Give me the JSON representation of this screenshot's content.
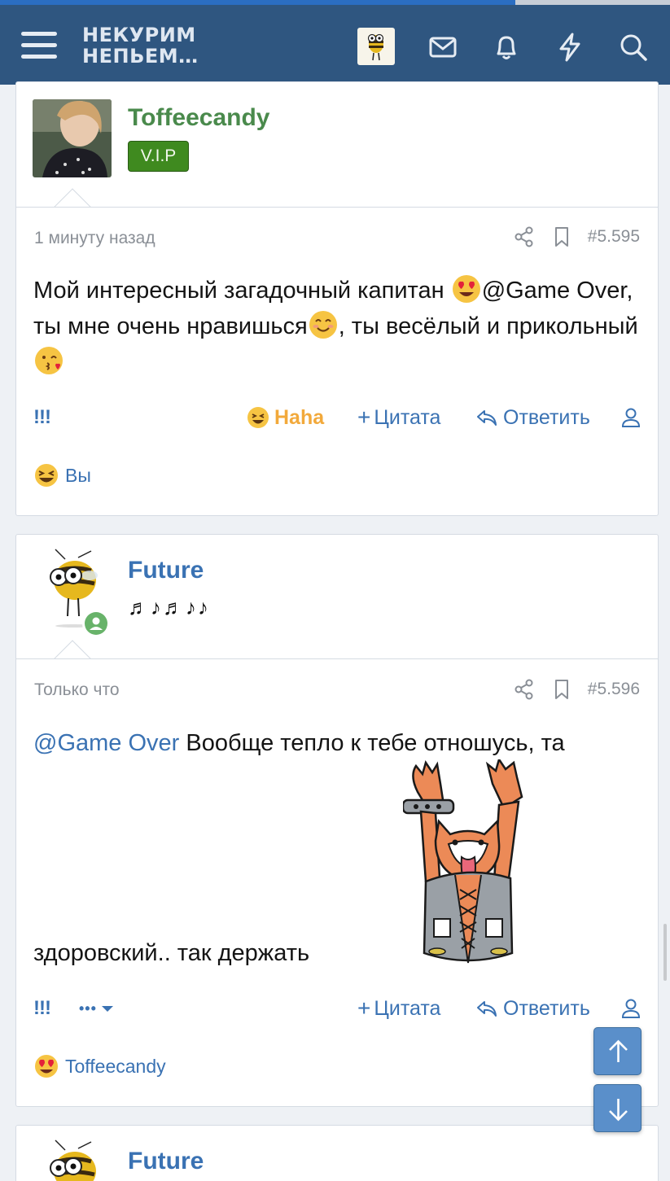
{
  "header": {
    "logo_line1": "НЕКУРИМ",
    "logo_line2": "НЕПЬЕМ…",
    "icons": [
      "menu-icon",
      "bee-avatar-icon",
      "mail-icon",
      "bell-icon",
      "lightning-icon",
      "search-icon"
    ]
  },
  "posts": [
    {
      "username": "Toffeecandy",
      "username_color": "#4a8a4c",
      "badge": "V.I.P",
      "time": "1 минуту назад",
      "number": "#5.595",
      "text_part1": "Мой интересный загадочный капитан ",
      "text_part2": "@Game Over, ты мне очень нравишься",
      "text_part3": ", ты весёлый и прикольный ",
      "bang": "!!!",
      "haha_label": "Haha",
      "quote_label": "Цитата",
      "reply_label": "Ответить",
      "reaction_user": "Вы"
    },
    {
      "username": "Future",
      "username_color": "#3a72b3",
      "user_title": "♬♪♬♪♪",
      "time": "Только что",
      "number": "#5.596",
      "mention": "@Game Over",
      "text_part1": " Вообще тепло к тебе отношусь, та",
      "text_part2": "здоровский.. так держать",
      "bang": "!!!",
      "more": "•••",
      "quote_label": "Цитата",
      "reply_label": "Ответить",
      "reaction_user": "Toffeecandy"
    },
    {
      "username": "Future",
      "username_color": "#3a72b3"
    }
  ],
  "colors": {
    "header_bg": "#2f5680",
    "link": "#3a72b3",
    "vip_badge": "#3f8a1f",
    "haha": "#f2a93b"
  }
}
